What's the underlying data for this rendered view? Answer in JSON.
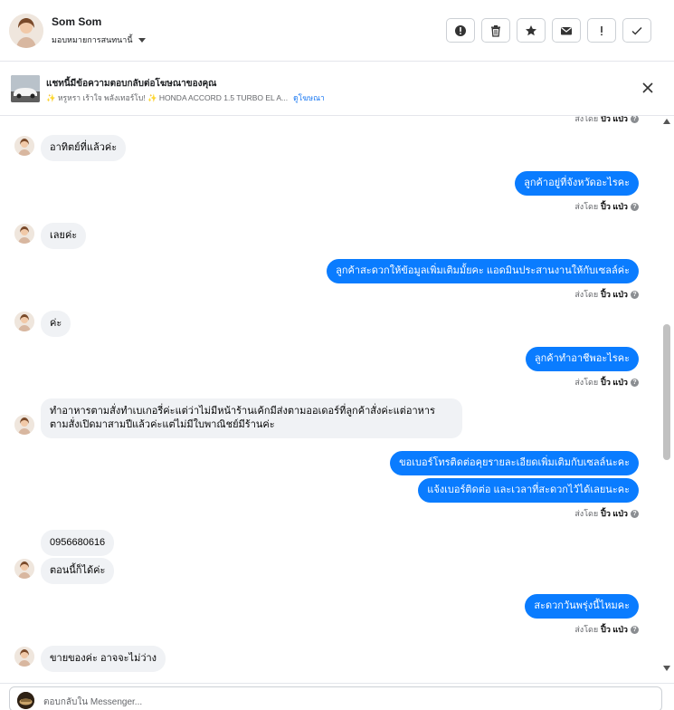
{
  "header": {
    "name": "Som Som",
    "assign": "มอบหมายการสนทนานี้",
    "actions": [
      "mark-spam-icon",
      "delete-icon",
      "star-icon",
      "mark-unread-icon",
      "follow-up-icon",
      "done-icon"
    ]
  },
  "banner": {
    "title": "แชทนี้มีข้อความตอบกลับต่อโฆษณาของคุณ",
    "ad_text": "✨ หรูหรา เร้าใจ พลังเทอร์โบ! ✨ HONDA ACCORD 1.5 TURBO EL A...",
    "link": "ดูโฆษณา"
  },
  "sent_by": {
    "label": "ส่งโดย",
    "name": "ปิ้ว แป่ว",
    "help": "?"
  },
  "messages": {
    "m1": "อาทิตย์ที่แล้วค่ะ",
    "m2": "ลูกค้าอยู่ที่จังหวัดอะไรคะ",
    "m3": "เลยค่ะ",
    "m4": "ลูกค้าสะดวกให้ข้อมูลเพิ่มเติมมั้ยคะ  แอดมินประสานงานให้กับเซลล์ค่ะ",
    "m5": "ค่ะ",
    "m6": "ลูกค้าทำอาชีพอะไรคะ",
    "m7": "ทำอาหารตามสั่งทำเบเกอรี่ค่ะแต่ว่าไม่มีหน้าร้านเค้กมีส่งตามออเดอร์ที่ลูกค้าสั่งค่ะแต่อาหารตามสั่งเปิดมาสามปีแล้วค่ะแต่ไม่มีใบพาณิชย์มีร้านค่ะ",
    "m8": "ขอเบอร์โทรติดต่อคุยรายละเอียดเพิ่มเติมกับเซลล์นะคะ",
    "m9": "แจ้งเบอร์ติดต่อ  และเวลาที่สะดวกไว้ได้เลยนะคะ",
    "m10": "0956680616",
    "m11": "ตอนนี้ก็ได้ค่ะ",
    "m12": "สะดวกวันพรุ่งนี้ไหมคะ",
    "m13": "ขายของค่ะ  อาจจะไม่ว่าง"
  },
  "composer": {
    "placeholder": "ตอบกลับใน Messenger..."
  },
  "colors": {
    "outgoing": "#0a7cff",
    "incoming": "#f0f2f5",
    "link": "#1877f2"
  }
}
